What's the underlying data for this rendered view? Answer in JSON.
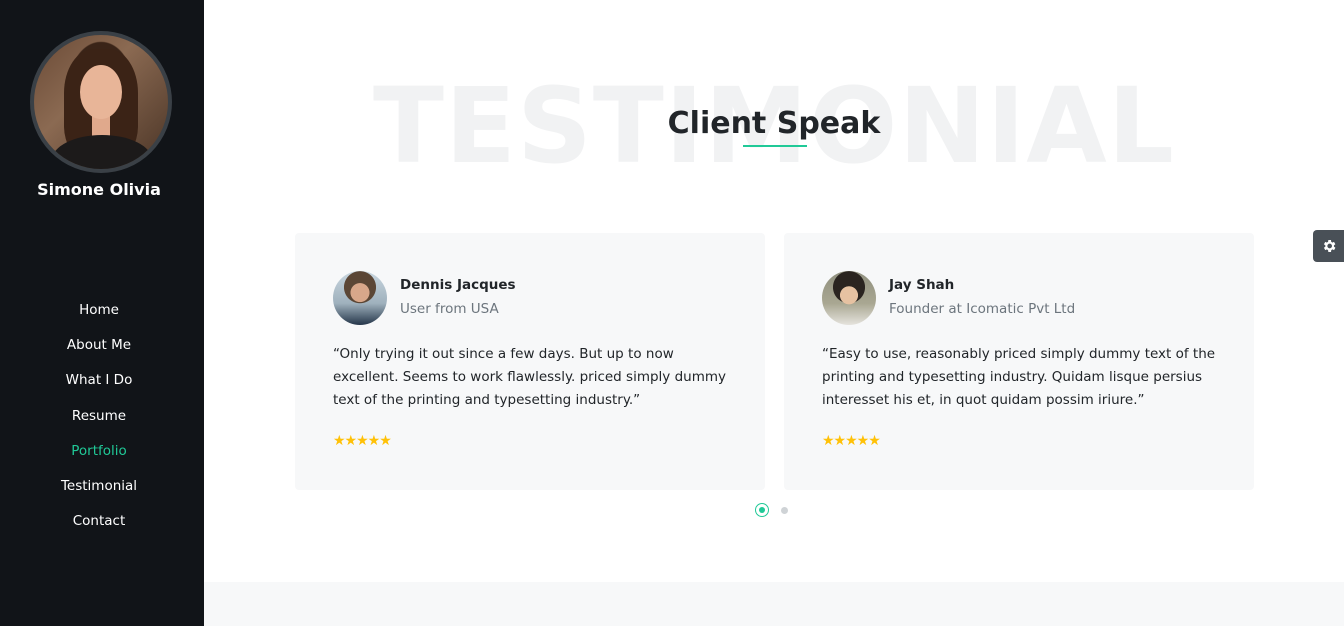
{
  "sidebar": {
    "name": "Simone Olivia",
    "nav": [
      {
        "label": "Home"
      },
      {
        "label": "About Me"
      },
      {
        "label": "What I Do"
      },
      {
        "label": "Resume"
      },
      {
        "label": "Portfolio"
      },
      {
        "label": "Testimonial"
      },
      {
        "label": "Contact"
      }
    ],
    "active_index": 4
  },
  "section": {
    "bg_title": "TESTIMONIAL",
    "title": "Client Speak"
  },
  "testimonials": [
    {
      "name": "Dennis Jacques",
      "role": "User from USA",
      "quote": "“Only trying it out since a few days. But up to now excellent. Seems to work flawlessly. priced simply dummy text of the printing and typesetting industry.”",
      "rating": "★★★★★"
    },
    {
      "name": "Jay Shah",
      "role": "Founder at Icomatic Pvt Ltd",
      "quote": "“Easy to use, reasonably priced simply dummy text of the printing and typesetting industry. Quidam lisque persius interesset his et, in quot quidam possim iriure.”",
      "rating": "★★★★★"
    }
  ],
  "carousel": {
    "active_dot": 1,
    "total_dots": 2
  },
  "settings_icon": "gear-icon",
  "colors": {
    "accent": "#20c997",
    "sidebar_bg": "#111418",
    "star": "#ffc107"
  }
}
